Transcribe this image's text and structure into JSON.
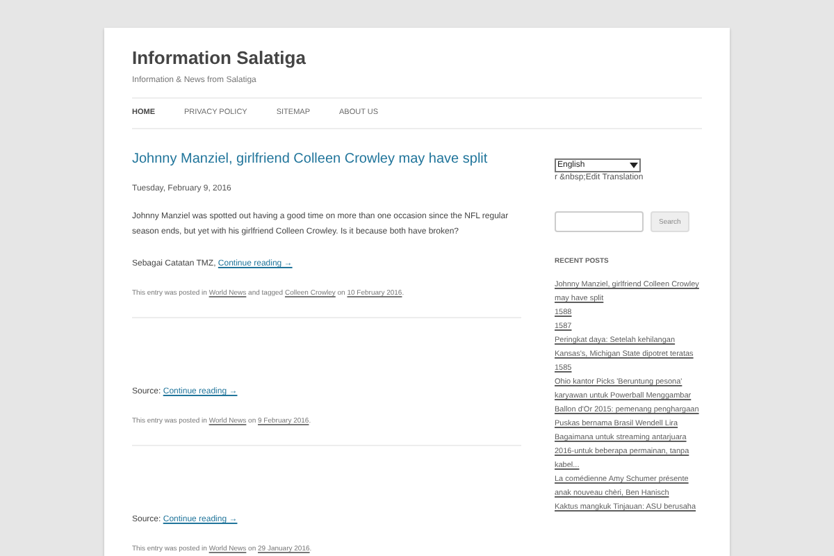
{
  "site": {
    "title": "Information Salatiga",
    "tagline": "Information & News from Salatiga"
  },
  "nav": [
    {
      "label": "HOME",
      "selected": true
    },
    {
      "label": "PRIVACY POLICY",
      "selected": false
    },
    {
      "label": "SITEMAP",
      "selected": false
    },
    {
      "label": "ABOUT US",
      "selected": false
    }
  ],
  "posts": [
    {
      "title": "Johnny Manziel, girlfriend Colleen Crowley may have split",
      "date": "Tuesday, February 9, 2016",
      "body": "Johnny Manziel was spotted out having a good time on more than one occasion since the NFL regular season ends, but yet with his girlfriend Colleen Crowley. Is it because both have broken?",
      "lead": "Sebagai Catatan TMZ, ",
      "more": "Continue reading →",
      "meta": [
        {
          "kind": "text",
          "text": "This entry was posted in "
        },
        {
          "kind": "link",
          "text": "World News"
        },
        {
          "kind": "text",
          "text": " and tagged "
        },
        {
          "kind": "link",
          "text": "Colleen Crowley"
        },
        {
          "kind": "text",
          "text": " on "
        },
        {
          "kind": "link",
          "text": "10 February 2016"
        },
        {
          "kind": "text",
          "text": "."
        }
      ]
    },
    {
      "lead": "Source: ",
      "more": "Continue reading →",
      "meta": [
        {
          "kind": "text",
          "text": "This entry was posted in "
        },
        {
          "kind": "link",
          "text": "World News"
        },
        {
          "kind": "text",
          "text": " on "
        },
        {
          "kind": "link",
          "text": "9 February 2016"
        },
        {
          "kind": "text",
          "text": "."
        }
      ]
    },
    {
      "lead": "Source: ",
      "more": "Continue reading →",
      "meta": [
        {
          "kind": "text",
          "text": "This entry was posted in "
        },
        {
          "kind": "link",
          "text": "World News"
        },
        {
          "kind": "text",
          "text": " on "
        },
        {
          "kind": "link",
          "text": "29 January 2016"
        },
        {
          "kind": "text",
          "text": "."
        }
      ]
    }
  ],
  "sidebar": {
    "language": {
      "value": "English",
      "edit": "r &nbsp;Edit Translation"
    },
    "search": {
      "button": "Search"
    },
    "recent_posts": {
      "heading": "RECENT POSTS",
      "items": [
        "Johnny Manziel, girlfriend Colleen Crowley may have split",
        "1588",
        "1587",
        "Peringkat daya: Setelah kehilangan Kansas's, Michigan State dipotret teratas",
        "1585",
        "Ohio kantor Picks 'Beruntung pesona' karyawan untuk Powerball Menggambar Ballon d'Or 2015: pemenang penghargaan Puskas bernama Brasil Wendell Lira",
        "Bagaimana untuk streaming antarjuara 2016-untuk beberapa permainan, tanpa kabel...",
        "La comédienne Amy Schumer présente anak nouveau chèri, Ben Hanisch",
        "Kaktus mangkuk Tinjauan: ASU berusaha"
      ]
    }
  }
}
